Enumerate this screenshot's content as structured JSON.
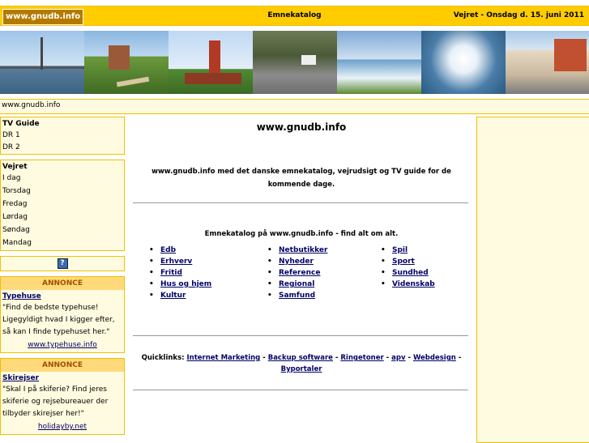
{
  "header": {
    "logo": "www.gnudb.info",
    "center": "Emnekatalog",
    "right": "Vejret - Onsdag d. 15. juni 2011"
  },
  "urlbar": "www.gnudb.info",
  "left": {
    "tv_title": "TV Guide",
    "tv_items": [
      "DR 1",
      "DR 2"
    ],
    "weather_title": "Vejret",
    "weather_items": [
      "I dag",
      "Torsdag",
      "Fredag",
      "Lørdag",
      "Søndag",
      "Mandag"
    ],
    "help_icon": "?",
    "ads": [
      {
        "label": "ANNONCE",
        "title": "Typehuse",
        "text": "\"Find de bedste typehuse! Ligegyldigt hvad I kigger efter, så kan I finde typehuset her.\"",
        "link": "www.typehuse.info"
      },
      {
        "label": "ANNONCE",
        "title": "Skirejser",
        "text": "\"Skal I på skiferie? Find jeres skiferie og rejsebureauer der tilbyder skirejser her!\"",
        "link": "holidayby.net"
      }
    ]
  },
  "main": {
    "title": "www.gnudb.info",
    "intro": "www.gnudb.info med det danske emnekatalog, vejrudsigt og TV guide for de kommende dage.",
    "catalog_title": "Emnekatalog på www.gnudb.info - find alt om alt.",
    "col1": [
      "Edb",
      "Erhverv",
      "Fritid",
      "Hus og hjem",
      "Kultur"
    ],
    "col2": [
      "Netbutikker",
      "Nyheder",
      "Reference",
      "Regional",
      "Samfund"
    ],
    "col3": [
      "Spil",
      "Sport",
      "Sundhed",
      "Videnskab"
    ],
    "quick_label": "Quicklinks:",
    "quick_links": [
      "Internet Marketing",
      "Backup software",
      "Ringetoner",
      "apv",
      "Webdesign",
      "Byportaler"
    ]
  },
  "colors": {
    "accent": "#ffcc00",
    "panel": "#fffbe0",
    "link": "#000066"
  }
}
